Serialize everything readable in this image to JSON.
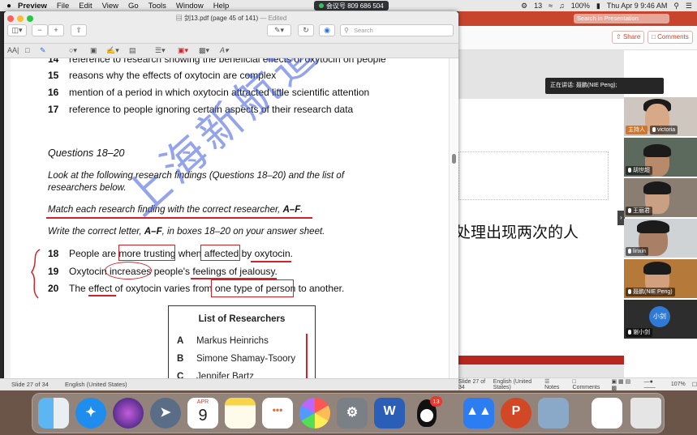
{
  "menubar": {
    "app": "Preview",
    "items": [
      "File",
      "Edit",
      "View",
      "Go",
      "Tools",
      "Window",
      "Help"
    ],
    "meeting": "会议号 809 686 504",
    "right": {
      "notification_count": "13",
      "battery": "100%",
      "clock": "Thu Apr 9  9:46 AM"
    }
  },
  "preview": {
    "filename": "剑13.pdf (page 45 of 141)",
    "edited": "— Edited",
    "search_placeholder": "Search",
    "questions_top": [
      {
        "num": "14",
        "text": "reference to research showing the beneficial effects of oxytocin on people"
      },
      {
        "num": "15",
        "text": "reasons why the effects of oxytocin are complex"
      },
      {
        "num": "16",
        "text": "mention of a period in which oxytocin attracted little scientific attention"
      },
      {
        "num": "17",
        "text": "reference to people ignoring certain aspects of their research data"
      }
    ],
    "section_heading": "Questions 18–20",
    "instruction1": "Look at the following research findings (Questions 18–20) and the list of researchers below.",
    "instruction2_pre": "Match each research finding with the correct researcher, ",
    "instruction2_bold": "A–F",
    "instruction2_post": ".",
    "instruction3_pre": "Write the correct letter, ",
    "instruction3_bold": "A–F",
    "instruction3_post": ", in boxes 18–20 on your answer sheet.",
    "q18": {
      "num": "18",
      "a": "People are ",
      "b": "more trusting",
      "c": " when ",
      "d": "affected",
      "e": " by ",
      "f": "oxytocin."
    },
    "q19": {
      "num": "19",
      "a": "Oxytocin ",
      "b": "increases",
      "c": " people's ",
      "d": "feelings of jealousy."
    },
    "q20": {
      "num": "20",
      "a": "The ",
      "b": "effect",
      "c": " of oxytocin varies from ",
      "d": "one type of person",
      "e": " to another."
    },
    "researchers_title": "List of Researchers",
    "researchers": [
      {
        "letter": "A",
        "name": "Markus Heinrichs"
      },
      {
        "letter": "B",
        "name": "Simone Shamay-Tsoory"
      },
      {
        "letter": "C",
        "name": "Jennifer Bartz"
      }
    ],
    "watermark": "上海新航道"
  },
  "powerpoint": {
    "search_placeholder": "Search in Presentation",
    "share": "Share",
    "comments": "Comments",
    "slide_text": "处理出现两次的人",
    "status": {
      "slide": "Slide 27 of 34",
      "language": "English (United States)",
      "notes": "Notes",
      "comments": "Comments",
      "zoom": "107%"
    }
  },
  "meeting": {
    "speaking": "正在讲话: 聂鹏(NIE Peng);",
    "participants": [
      {
        "name": "victoria",
        "role": "主持人"
      },
      {
        "name": "胡世超"
      },
      {
        "name": "王丽君"
      },
      {
        "name": "linxin"
      },
      {
        "name": "聂鹏(NIE Peng)"
      },
      {
        "name": "谢小剑",
        "avatar": "小剑"
      }
    ]
  },
  "dock": {
    "calendar_month": "APR",
    "calendar_day": "9",
    "qq_badge": "13"
  }
}
